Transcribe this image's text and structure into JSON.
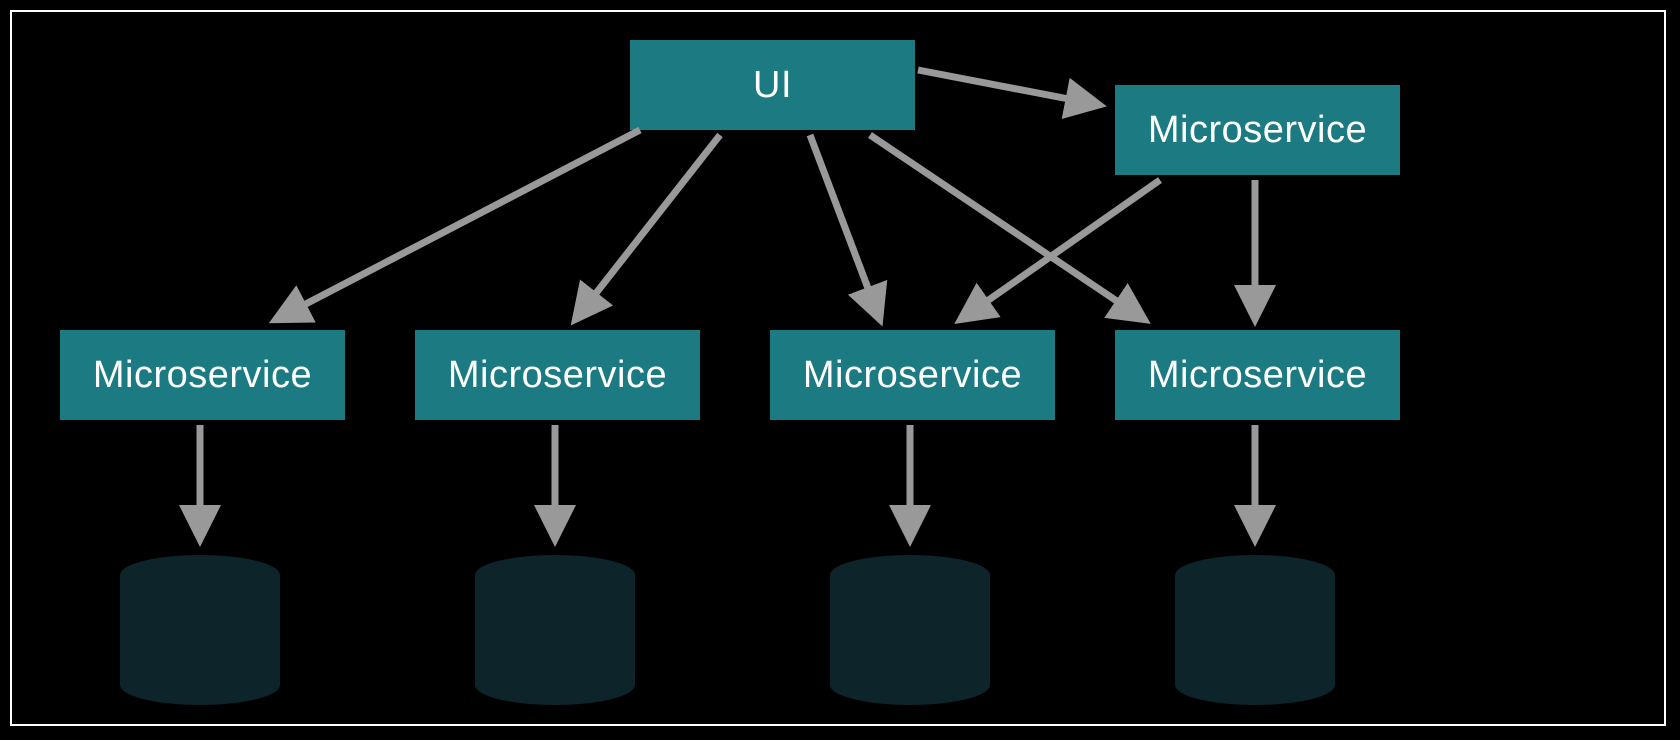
{
  "diagram": {
    "ui_label": "UI",
    "top_microservice_label": "Microservice",
    "row_microservices": [
      {
        "label": "Microservice"
      },
      {
        "label": "Microservice"
      },
      {
        "label": "Microservice"
      },
      {
        "label": "Microservice"
      }
    ],
    "colors": {
      "box_fill": "#1c7b82",
      "db_fill": "#0c242a",
      "arrow": "#999999",
      "frame": "#ffffff",
      "background": "#000000"
    },
    "arrows": [
      {
        "from": "ui",
        "to": "microservice-1"
      },
      {
        "from": "ui",
        "to": "microservice-2"
      },
      {
        "from": "ui",
        "to": "microservice-3"
      },
      {
        "from": "ui",
        "to": "microservice-top"
      },
      {
        "from": "microservice-top",
        "to": "microservice-3"
      },
      {
        "from": "microservice-top",
        "to": "microservice-4"
      },
      {
        "from": "microservice-1",
        "to": "database-1"
      },
      {
        "from": "microservice-2",
        "to": "database-2"
      },
      {
        "from": "microservice-3",
        "to": "database-3"
      },
      {
        "from": "microservice-4",
        "to": "database-4"
      }
    ]
  }
}
